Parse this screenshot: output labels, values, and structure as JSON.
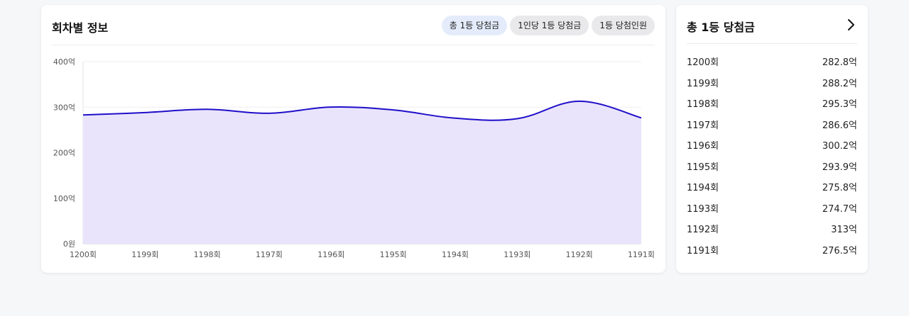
{
  "chart_panel": {
    "title": "회차별 정보",
    "tabs": [
      "총 1등 당첨금",
      "1인당 1등 당첨금",
      "1등 당첨인원"
    ],
    "active_tab": 0
  },
  "list_panel": {
    "title": "총 1등 당첨금",
    "rows": [
      {
        "round": "1200회",
        "amount": "282.8억"
      },
      {
        "round": "1199회",
        "amount": "288.2억"
      },
      {
        "round": "1198회",
        "amount": "295.3억"
      },
      {
        "round": "1197회",
        "amount": "286.6억"
      },
      {
        "round": "1196회",
        "amount": "300.2억"
      },
      {
        "round": "1195회",
        "amount": "293.9억"
      },
      {
        "round": "1194회",
        "amount": "275.8억"
      },
      {
        "round": "1193회",
        "amount": "274.7억"
      },
      {
        "round": "1192회",
        "amount": "313억"
      },
      {
        "round": "1191회",
        "amount": "276.5억"
      }
    ]
  },
  "colors": {
    "line": "#1f0ec9",
    "fill": "#e9e4fb",
    "active_tab_bg": "#e4ecfb",
    "tab_bg": "#e9e9eb"
  },
  "chart_data": {
    "type": "area",
    "categories": [
      "1200회",
      "1199회",
      "1198회",
      "1197회",
      "1196회",
      "1195회",
      "1194회",
      "1193회",
      "1192회",
      "1191회"
    ],
    "series": [
      {
        "values": [
          282.8,
          288.2,
          295.3,
          286.6,
          300.2,
          293.9,
          275.8,
          274.7,
          313,
          276.5
        ]
      }
    ],
    "ylim": [
      0,
      400
    ],
    "yticks": [
      0,
      100,
      200,
      300,
      400
    ],
    "ytick_labels": [
      "0원",
      "100억",
      "200억",
      "300억",
      "400억"
    ],
    "grid": true,
    "legend": "none"
  }
}
